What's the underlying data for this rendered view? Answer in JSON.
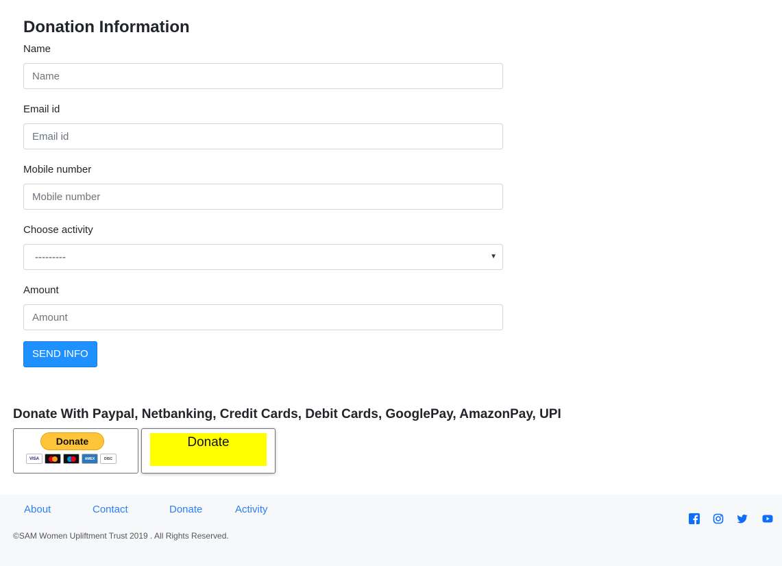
{
  "form": {
    "title": "Donation Information",
    "name_label": "Name",
    "name_placeholder": "Name",
    "email_label": "Email id",
    "email_placeholder": "Email id",
    "mobile_label": "Mobile number",
    "mobile_placeholder": "Mobile number",
    "activity_label": "Choose activity",
    "activity_selected": "---------",
    "amount_label": "Amount",
    "amount_placeholder": "Amount",
    "submit_label": "SEND INFO"
  },
  "donate_section": {
    "title": "Donate With Paypal, Netbanking, Credit Cards, Debit Cards, GooglePay, AmazonPay, UPI",
    "paypal_button_label": "Donate",
    "card_logos": [
      "visa",
      "mastercard",
      "maestro",
      "american-express",
      "discover"
    ],
    "upi_button_label": "Donate",
    "upi_button_color": "#ffff00"
  },
  "footer": {
    "links": [
      "About",
      "Contact",
      "Donate",
      "Activity"
    ],
    "copyright": "©SAM Women Upliftment Trust 2019 . All Rights Reserved.",
    "social_icons": [
      "facebook-icon",
      "instagram-icon",
      "twitter-icon",
      "youtube-icon"
    ]
  },
  "colors": {
    "primary_button": "#1e90ff",
    "link": "#2a7ff6",
    "footer_background": "#f7f8fa",
    "social_icon": "#0d6efd"
  }
}
